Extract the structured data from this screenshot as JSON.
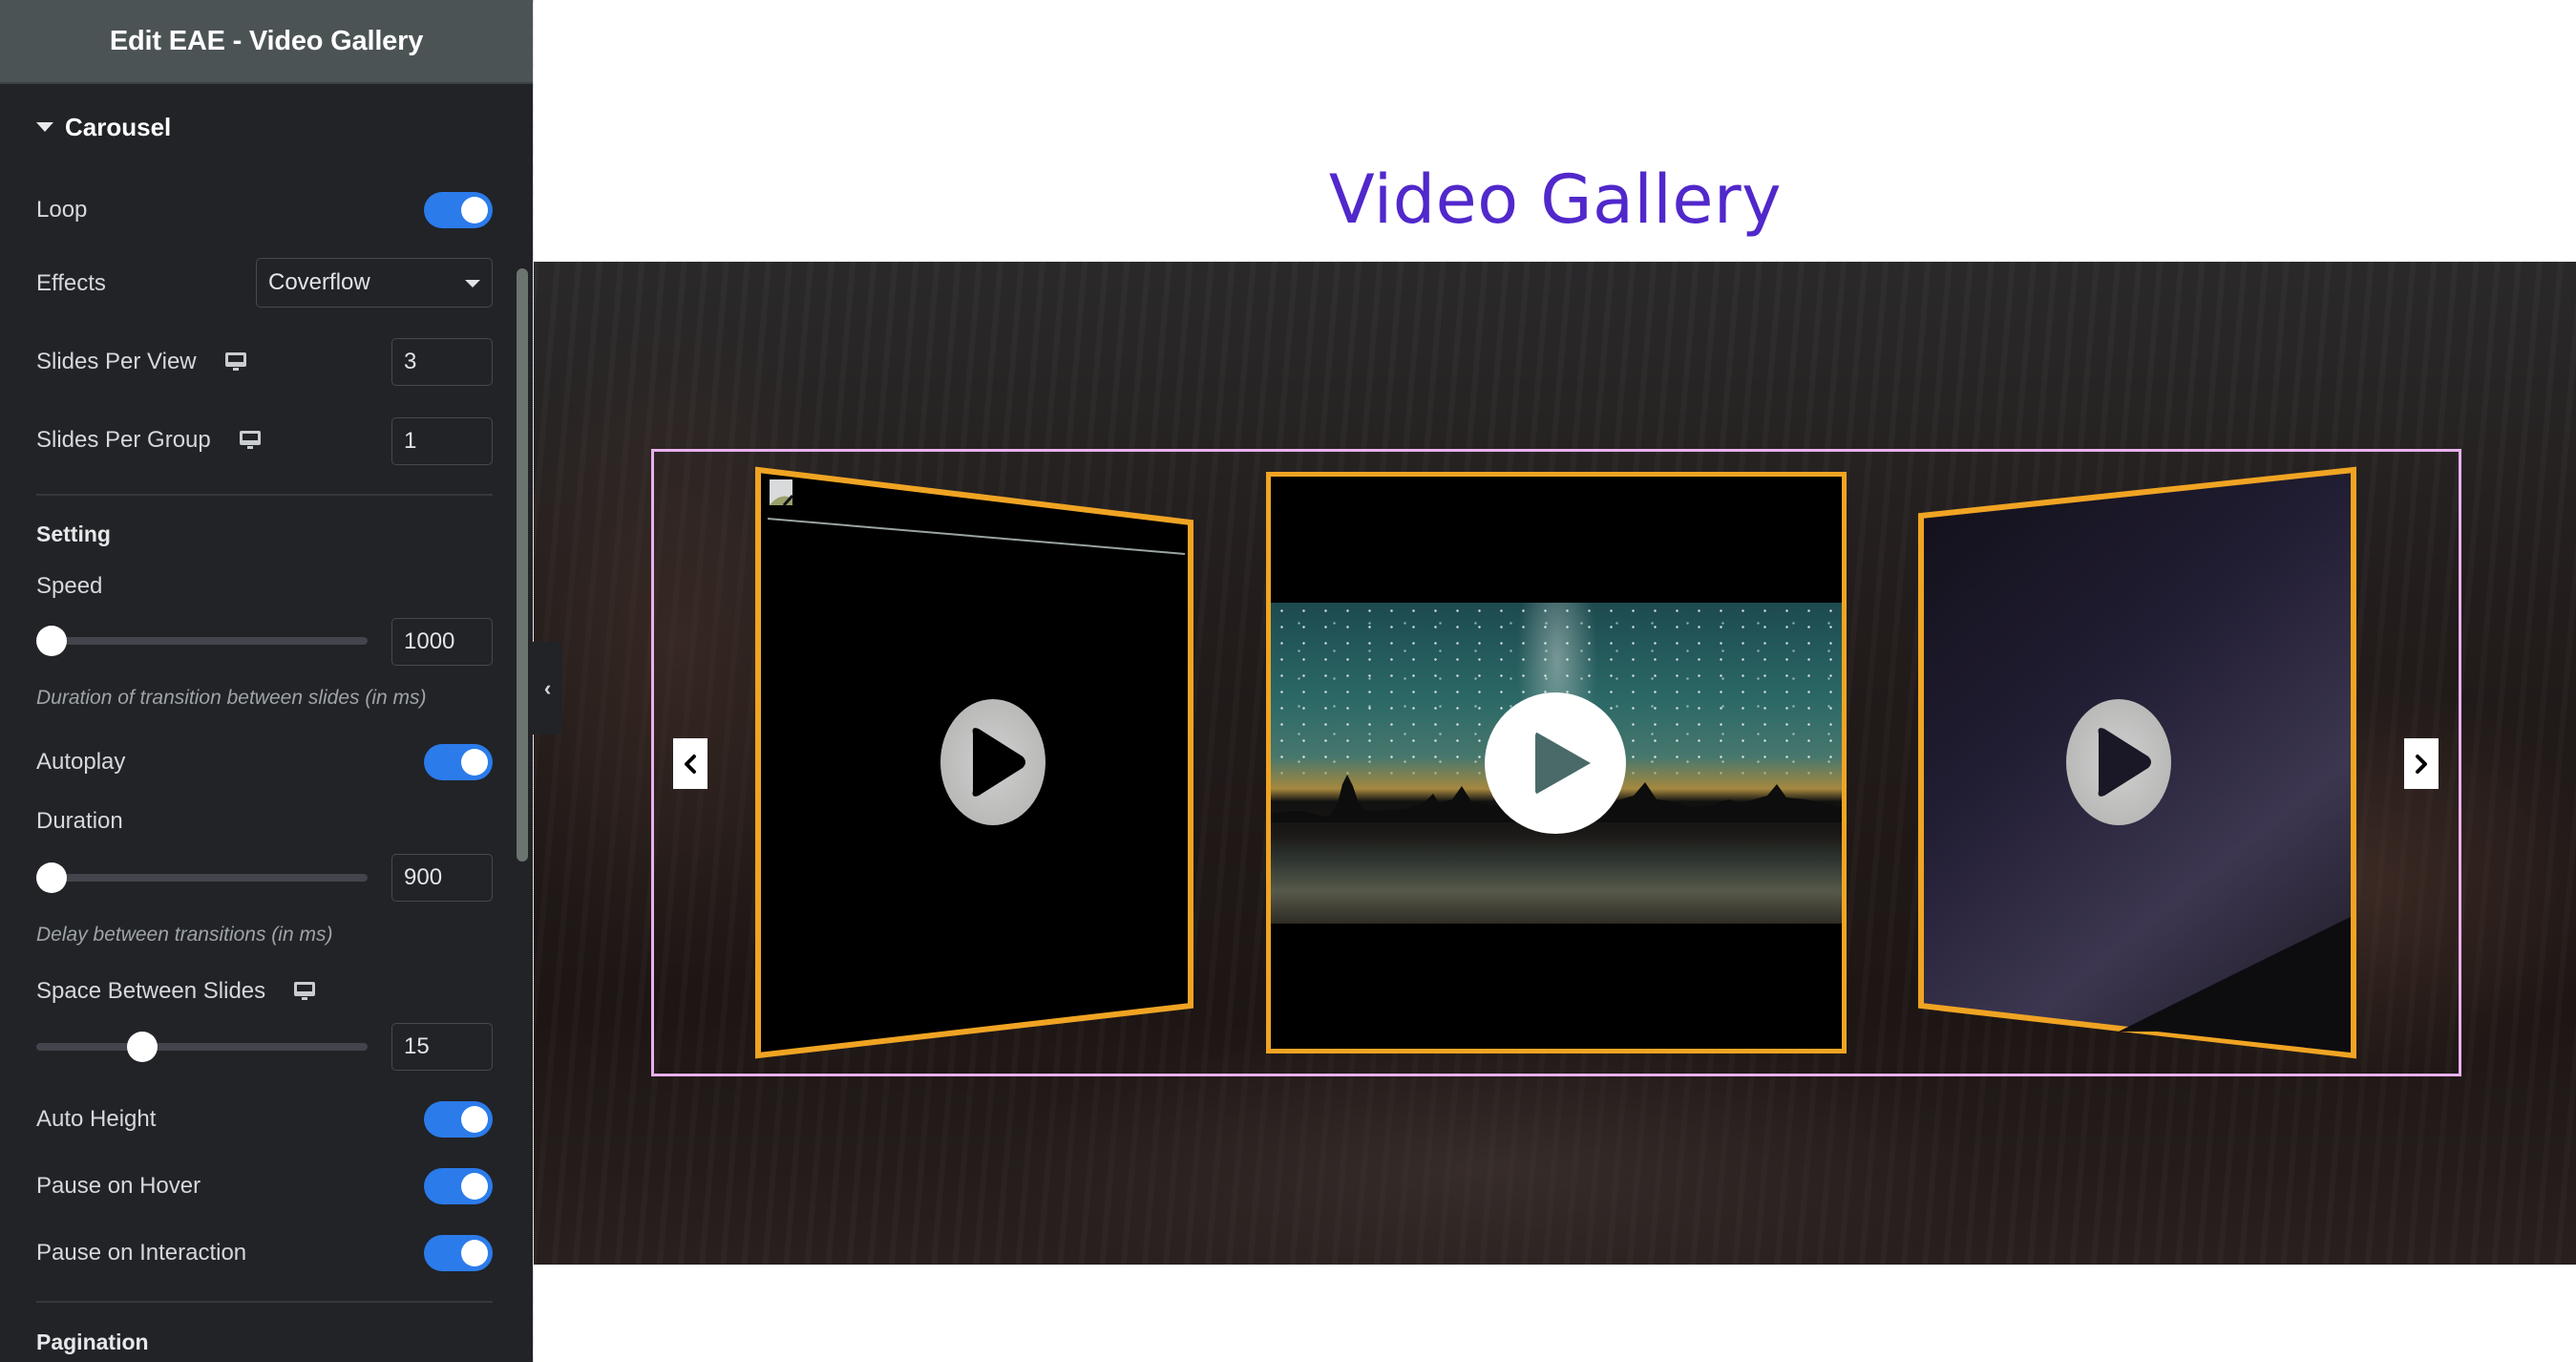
{
  "sidebar": {
    "header_title": "Edit EAE - Video Gallery",
    "section_label": "Carousel",
    "loop": {
      "label": "Loop",
      "enabled": true
    },
    "effects": {
      "label": "Effects",
      "value": "Coverflow"
    },
    "slides_per_view": {
      "label": "Slides Per View",
      "value": "3",
      "device_icon": "desktop-icon"
    },
    "slides_per_group": {
      "label": "Slides Per Group",
      "value": "1",
      "device_icon": "desktop-icon"
    },
    "setting_heading": "Setting",
    "speed": {
      "label": "Speed",
      "value": "1000",
      "slider_fraction": 0.0,
      "description": "Duration of transition between slides (in ms)"
    },
    "autoplay": {
      "label": "Autoplay",
      "enabled": true
    },
    "duration": {
      "label": "Duration",
      "value": "900",
      "slider_fraction": 0.0,
      "description": "Delay between transitions (in ms)"
    },
    "space_between": {
      "label": "Space Between Slides",
      "value": "15",
      "slider_fraction": 0.3,
      "device_icon": "desktop-icon"
    },
    "auto_height": {
      "label": "Auto Height",
      "enabled": true
    },
    "pause_on_hover": {
      "label": "Pause on Hover",
      "enabled": true
    },
    "pause_on_interaction": {
      "label": "Pause on Interaction",
      "enabled": true
    },
    "pagination_heading": "Pagination",
    "collapse_icon": "chevron-left-icon"
  },
  "preview": {
    "title": "Video Gallery",
    "title_color": "#5128cb",
    "slide_border_color": "#f0a423",
    "container_outline_color": "#e9b0ee",
    "toggle_color": "#2b7bea",
    "slides": [
      {
        "position": "left",
        "thumbnail": "broken-image-icon",
        "play_icon": "play-icon"
      },
      {
        "position": "center",
        "thumbnail": "night-sky-lake",
        "play_icon": "play-icon"
      },
      {
        "position": "right",
        "thumbnail": "milky-way-sky",
        "play_icon": "play-icon"
      }
    ],
    "prev_icon": "chevron-left-icon",
    "next_icon": "chevron-right-icon"
  }
}
